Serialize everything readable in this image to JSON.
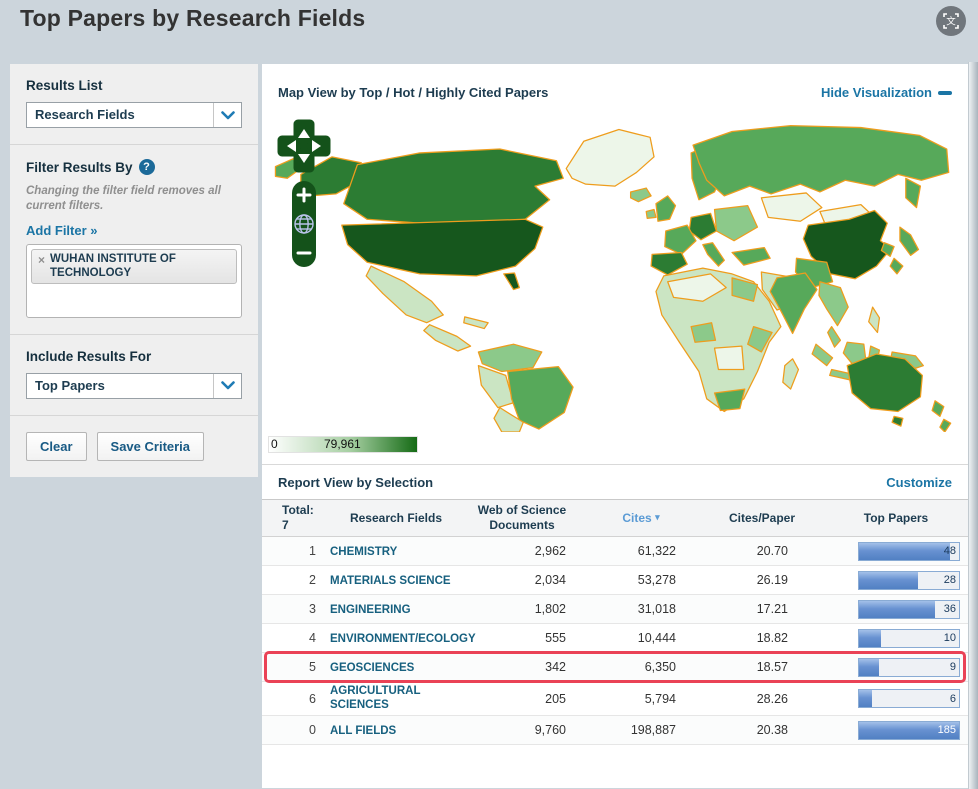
{
  "page": {
    "title": "Top Papers by Research Fields"
  },
  "header": {
    "icon": "translate-icon"
  },
  "sidebar": {
    "results_list": {
      "label": "Results List",
      "value": "Research Fields"
    },
    "filter": {
      "heading": "Filter Results By",
      "note": "Changing the filter field removes all current filters.",
      "add_link": "Add Filter »",
      "chip_remove": "×",
      "chip": "WUHAN INSTITUTE OF TECHNOLOGY"
    },
    "include": {
      "label": "Include Results For",
      "value": "Top Papers"
    },
    "actions": {
      "clear": "Clear",
      "save": "Save Criteria"
    }
  },
  "map_panel": {
    "title": "Map View by Top / Hot / Highly Cited Papers",
    "hide_link": "Hide Visualization",
    "zoom_in": "+",
    "zoom_out": "−",
    "legend": {
      "min": "0",
      "max": "79,961"
    },
    "palette": {
      "border": "#ee9d1d",
      "level0": "#edf6e9",
      "level1": "#cbe5c3",
      "level2": "#8cc98a",
      "level3": "#57a95a",
      "level4": "#2c7c33",
      "level5": "#16571d",
      "control_green": "#14521a",
      "bar_blue": "#5180c3",
      "highlight_red": "#ea4256"
    }
  },
  "report": {
    "heading": "Report View by Selection",
    "customize": "Customize",
    "table": {
      "total_label": "Total:",
      "total_value": "7",
      "col_field": "Research Fields",
      "col_docs": "Web of Science Documents",
      "col_cites": "Cites",
      "sort_icon": "▾",
      "col_cpp": "Cites/Paper",
      "col_top": "Top Papers"
    },
    "rows": [
      {
        "rank": "1",
        "field": "CHEMISTRY",
        "docs": "2,962",
        "cites": "61,322",
        "cpp": "20.70",
        "top": "48",
        "bar_pct": 91,
        "highlighted": false
      },
      {
        "rank": "2",
        "field": "MATERIALS SCIENCE",
        "docs": "2,034",
        "cites": "53,278",
        "cpp": "26.19",
        "top": "28",
        "bar_pct": 59,
        "highlighted": false
      },
      {
        "rank": "3",
        "field": "ENGINEERING",
        "docs": "1,802",
        "cites": "31,018",
        "cpp": "17.21",
        "top": "36",
        "bar_pct": 76,
        "highlighted": false
      },
      {
        "rank": "4",
        "field": "ENVIRONMENT/ECOLOGY",
        "docs": "555",
        "cites": "10,444",
        "cpp": "18.82",
        "top": "10",
        "bar_pct": 22,
        "highlighted": false
      },
      {
        "rank": "5",
        "field": "GEOSCIENCES",
        "docs": "342",
        "cites": "6,350",
        "cpp": "18.57",
        "top": "9",
        "bar_pct": 20,
        "highlighted": true
      },
      {
        "rank": "6",
        "field": "AGRICULTURAL SCIENCES",
        "docs": "205",
        "cites": "5,794",
        "cpp": "28.26",
        "top": "6",
        "bar_pct": 13,
        "highlighted": false
      },
      {
        "rank": "0",
        "field": "ALL FIELDS",
        "docs": "9,760",
        "cites": "198,887",
        "cpp": "20.38",
        "top": "185",
        "bar_pct": 100,
        "highlighted": false
      }
    ]
  }
}
